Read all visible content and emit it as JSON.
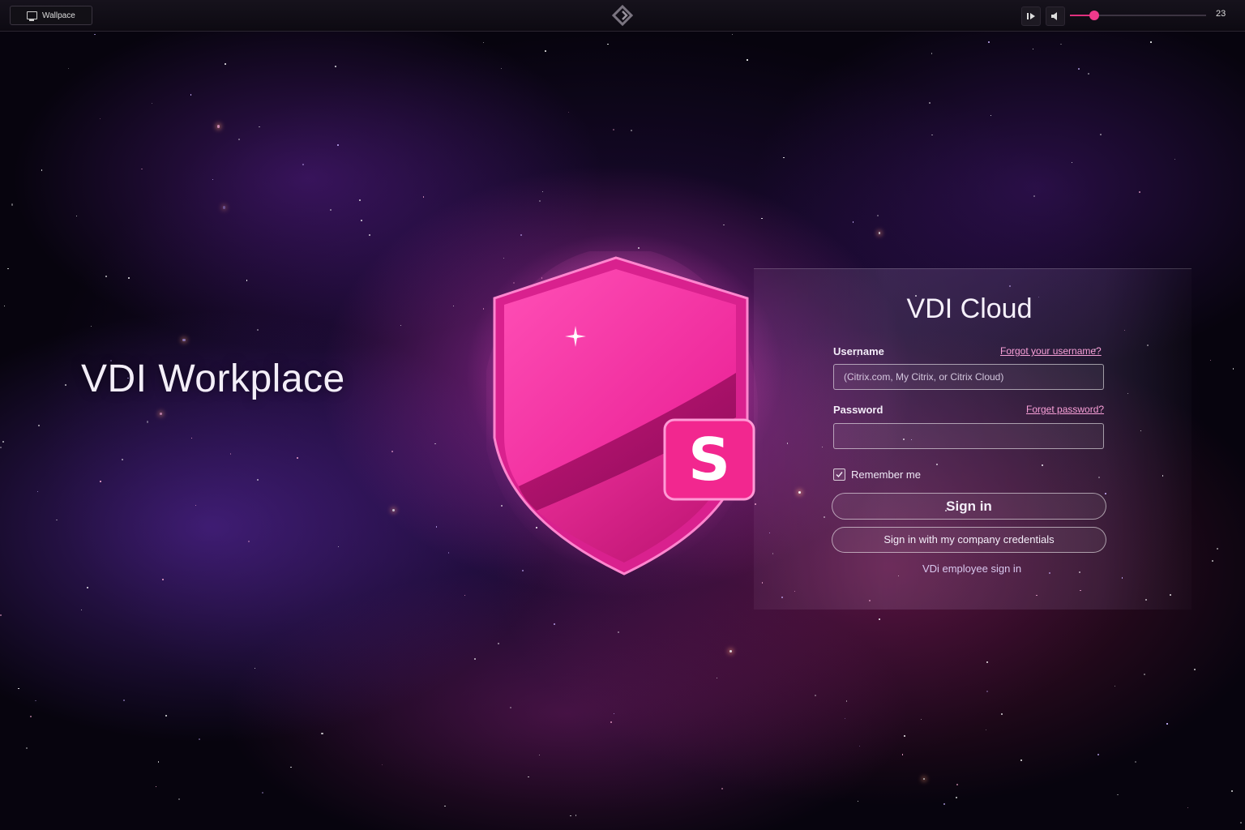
{
  "topbar": {
    "workspace_label": "Wallpace",
    "volume_level": 0.18,
    "counter": "23",
    "icons": [
      "monitor-icon",
      "diamond-logo-icon",
      "play-pause-icon",
      "speaker-icon"
    ]
  },
  "headline": "VDI Workplace",
  "logo": {
    "letter": "S",
    "color": "#ff3aa8"
  },
  "login": {
    "title": "VDI Cloud",
    "username_label": "Username",
    "forgot_username": "Forgot your username?",
    "username_placeholder": "(Citrix.com, My Citrix, or Citrix Cloud)",
    "username_value": "",
    "password_label": "Password",
    "forgot_password": "Forget password?",
    "password_value": "",
    "remember_label": "Remember me",
    "remember_checked": true,
    "sign_in": "Sign in",
    "company_sign_in": "Sign in with my company credentials",
    "employee_sign_in": "VDi employee sign in"
  },
  "colors": {
    "accent": "#ee3a8c",
    "link": "#f8a0d8"
  }
}
